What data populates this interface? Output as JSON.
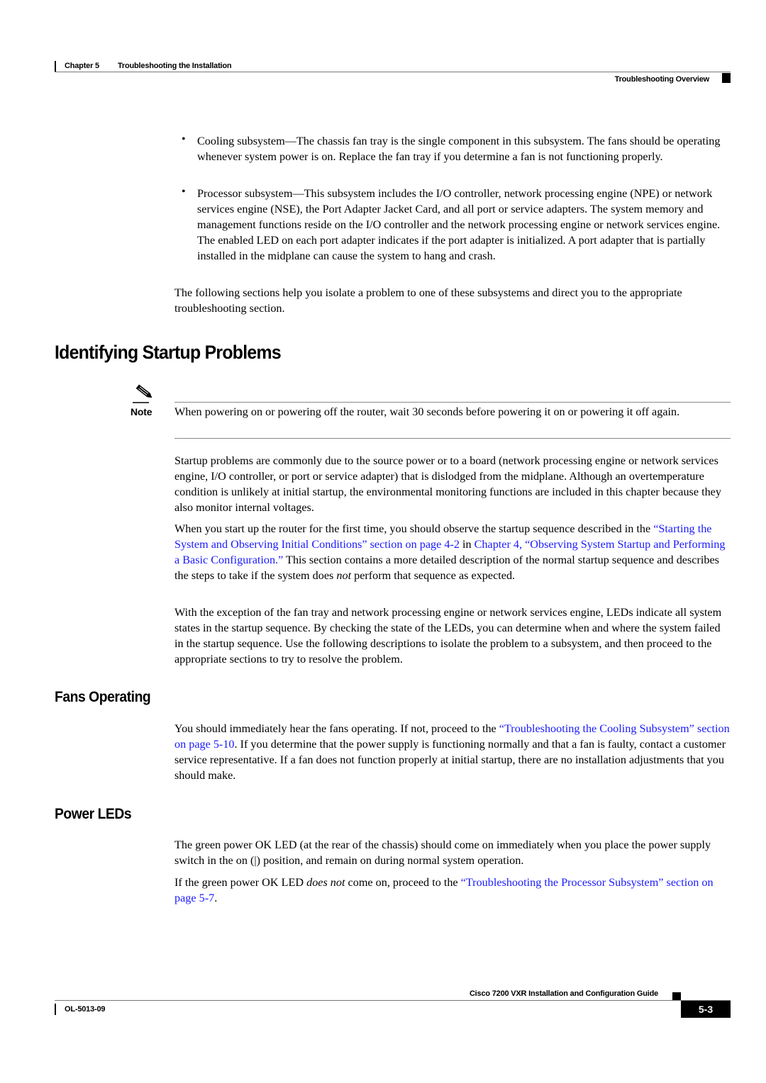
{
  "header": {
    "chapter_label": "Chapter 5",
    "chapter_title": "Troubleshooting the Installation",
    "section_title": "Troubleshooting Overview"
  },
  "bullets": [
    {
      "text": "Cooling subsystem—The chassis fan tray is the single component in this subsystem. The fans should be operating whenever system power is on. Replace the fan tray if you determine a fan is not functioning properly."
    },
    {
      "text": "Processor subsystem—This subsystem includes the I/O controller, network processing engine (NPE) or network services engine (NSE), the Port Adapter Jacket Card, and all port or service adapters. The system memory and management functions reside on the I/O controller and the network processing engine or network services engine. The enabled LED on each port adapter indicates if the port adapter is initialized. A port adapter that is partially installed in the midplane can cause the system to hang and crash."
    }
  ],
  "intro_para": "The following sections help you isolate a problem to one of these subsystems and direct you to the appropriate troubleshooting section.",
  "section1": {
    "title": "Identifying Startup Problems",
    "note_label": "Note",
    "note_text": "When powering on or powering off the router, wait 30 seconds before powering it on or powering it off again.",
    "para1": "Startup problems are commonly due to the source power or to a board (network processing engine or network services engine, I/O controller, or port or service adapter) that is dislodged from the midplane. Although an overtemperature condition is unlikely at initial startup, the environmental monitoring functions are included in this chapter because they also monitor internal voltages.",
    "para2": {
      "t1": "When you start up the router for the first time, you should observe the startup sequence described in the ",
      "link1": "“Starting the System and Observing Initial Conditions” section on page 4-2",
      "t2": " in ",
      "link2": "Chapter 4, “Observing System Startup and Performing a Basic Configuration.”",
      "t3": " This section contains a more detailed description of the normal startup sequence and describes the steps to take if the system does ",
      "em": "not",
      "t4": " perform that sequence as expected."
    },
    "para3": "With the exception of the fan tray and network processing engine or network services engine, LEDs indicate all system states in the startup sequence. By checking the state of the LEDs, you can determine when and where the system failed in the startup sequence. Use the following descriptions to isolate the problem to a subsystem, and then proceed to the appropriate sections to try to resolve the problem."
  },
  "section2": {
    "title": "Fans Operating",
    "t1": "You should immediately hear the fans operating. If not, proceed to the ",
    "link": "“Troubleshooting the Cooling Subsystem” section on page 5-10",
    "t2": ". If you determine that the power supply is functioning normally and that a fan is faulty, contact a customer service representative. If a fan does not function properly at initial startup, there are no installation adjustments that you should make."
  },
  "section3": {
    "title": "Power LEDs",
    "para1": "The green power OK LED (at the rear of the chassis) should come on immediately when you place the power supply switch in the on (|) position, and remain on during normal system operation.",
    "p2_t1": "If the green power OK LED ",
    "p2_em": "does not",
    "p2_t2": " come on, proceed to the ",
    "p2_link": "“Troubleshooting the Processor Subsystem” section on page 5-7",
    "p2_t3": "."
  },
  "footer": {
    "guide_title": "Cisco 7200 VXR Installation and Configuration Guide",
    "doc_number": "OL-5013-09",
    "page_number": "5-3"
  }
}
